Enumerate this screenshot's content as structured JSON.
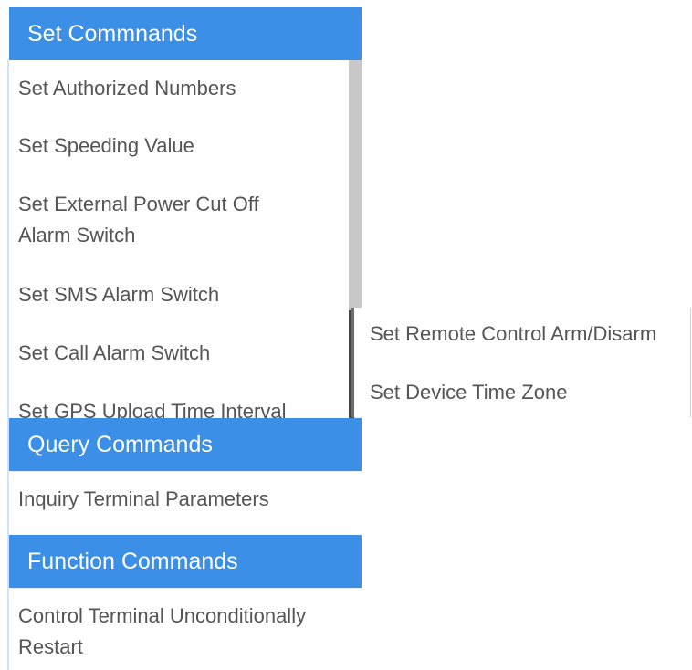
{
  "set_commands": {
    "title": "Set Commnands",
    "items": [
      "Set Authorized Numbers",
      "Set Speeding Value",
      "Set External Power Cut Off",
      "Alarm Switch",
      "Set SMS Alarm Switch",
      "Set Call Alarm Switch",
      "Set GPS Upload Time Interval"
    ],
    "submenu": [
      "Set Remote Control Arm/Disarm",
      "Set Device Time Zone"
    ]
  },
  "query_commands": {
    "title": "Query Commands",
    "items": [
      "Inquiry Terminal Parameters"
    ]
  },
  "function_commands": {
    "title": "Function Commands",
    "items": [
      "Control Terminal Unconditionally",
      "Restart"
    ]
  },
  "colors": {
    "header_bg": "#3b8fe6",
    "header_text": "#ffffff",
    "item_text": "#555555"
  }
}
